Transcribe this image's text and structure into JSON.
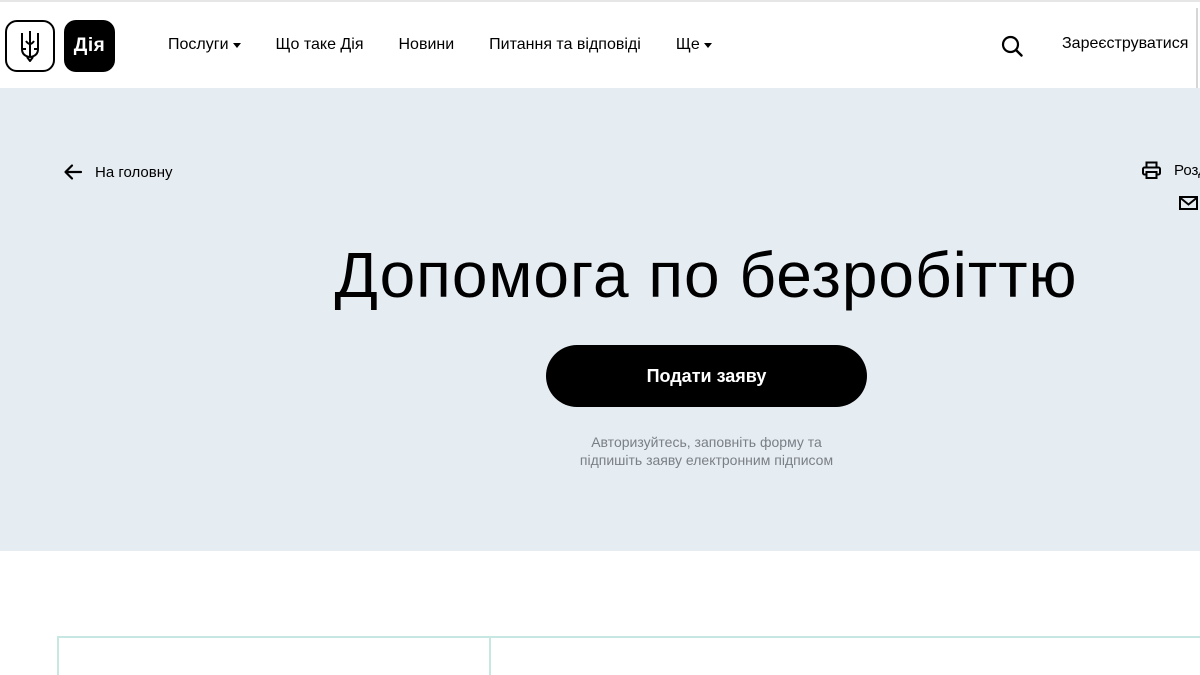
{
  "header": {
    "logo_text": "Дія",
    "nav": {
      "services": "Послуги",
      "about": "Що таке Дія",
      "news": "Новини",
      "faq": "Питання та відповіді",
      "more": "Ще"
    },
    "register": "Зареєструватися"
  },
  "hero": {
    "back_label": "На головну",
    "print_label": "Розд",
    "title": "Допомога по безробіттю",
    "apply_button": "Подати заяву",
    "hint_line1": "Авторизуйтесь, заповніть форму та",
    "hint_line2": "підпишіть заяву електронним підписом"
  },
  "colors": {
    "hero_background": "#e5ecf2",
    "button_background": "#000000",
    "hint_text": "#7a7f86",
    "content_border": "#c7e8e2"
  },
  "icons": [
    "trident-icon",
    "search-icon",
    "arrow-left-icon",
    "printer-icon",
    "mail-icon",
    "chevron-down-icon"
  ]
}
